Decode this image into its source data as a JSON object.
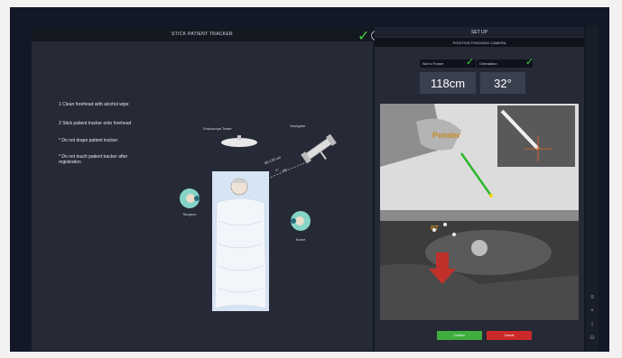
{
  "left_panel": {
    "title": "STICK PATIENT TRACKER",
    "instructions": [
      "1 Clean forehead with alcohol wipe",
      "2 Stick patient tracker onto forehead",
      "* Do not drape patient tracker",
      "* Do not touch patient tracker after registration"
    ],
    "labels": {
      "endoscope_tower": "Endoscope Tower",
      "navigator": "Navigator",
      "distance": "80-130 cm",
      "angle": "0° - 45°",
      "surgeon": "Surgeon",
      "nurse": "Nurse"
    }
  },
  "right_panel": {
    "title": "SET UP",
    "subtitle": "POSITION TRACKING CAMERA",
    "info_label_1": "Not to Frame",
    "info_label_2": "Orientation",
    "distance_value": "118cm",
    "orientation_value": "32°",
    "pointer_label": "Pointer",
    "pt_label": "PT",
    "confirm_label": "Confirm",
    "cancel_label": "Cancel"
  },
  "sidebar": {
    "icons": [
      "layers-icon",
      "plus-icon",
      "info-icon",
      "power-icon"
    ]
  },
  "colors": {
    "accent_green": "#3bd13b",
    "confirm": "#3fae3f",
    "cancel": "#cc2a2a",
    "pointer_label": "#c48a22"
  }
}
